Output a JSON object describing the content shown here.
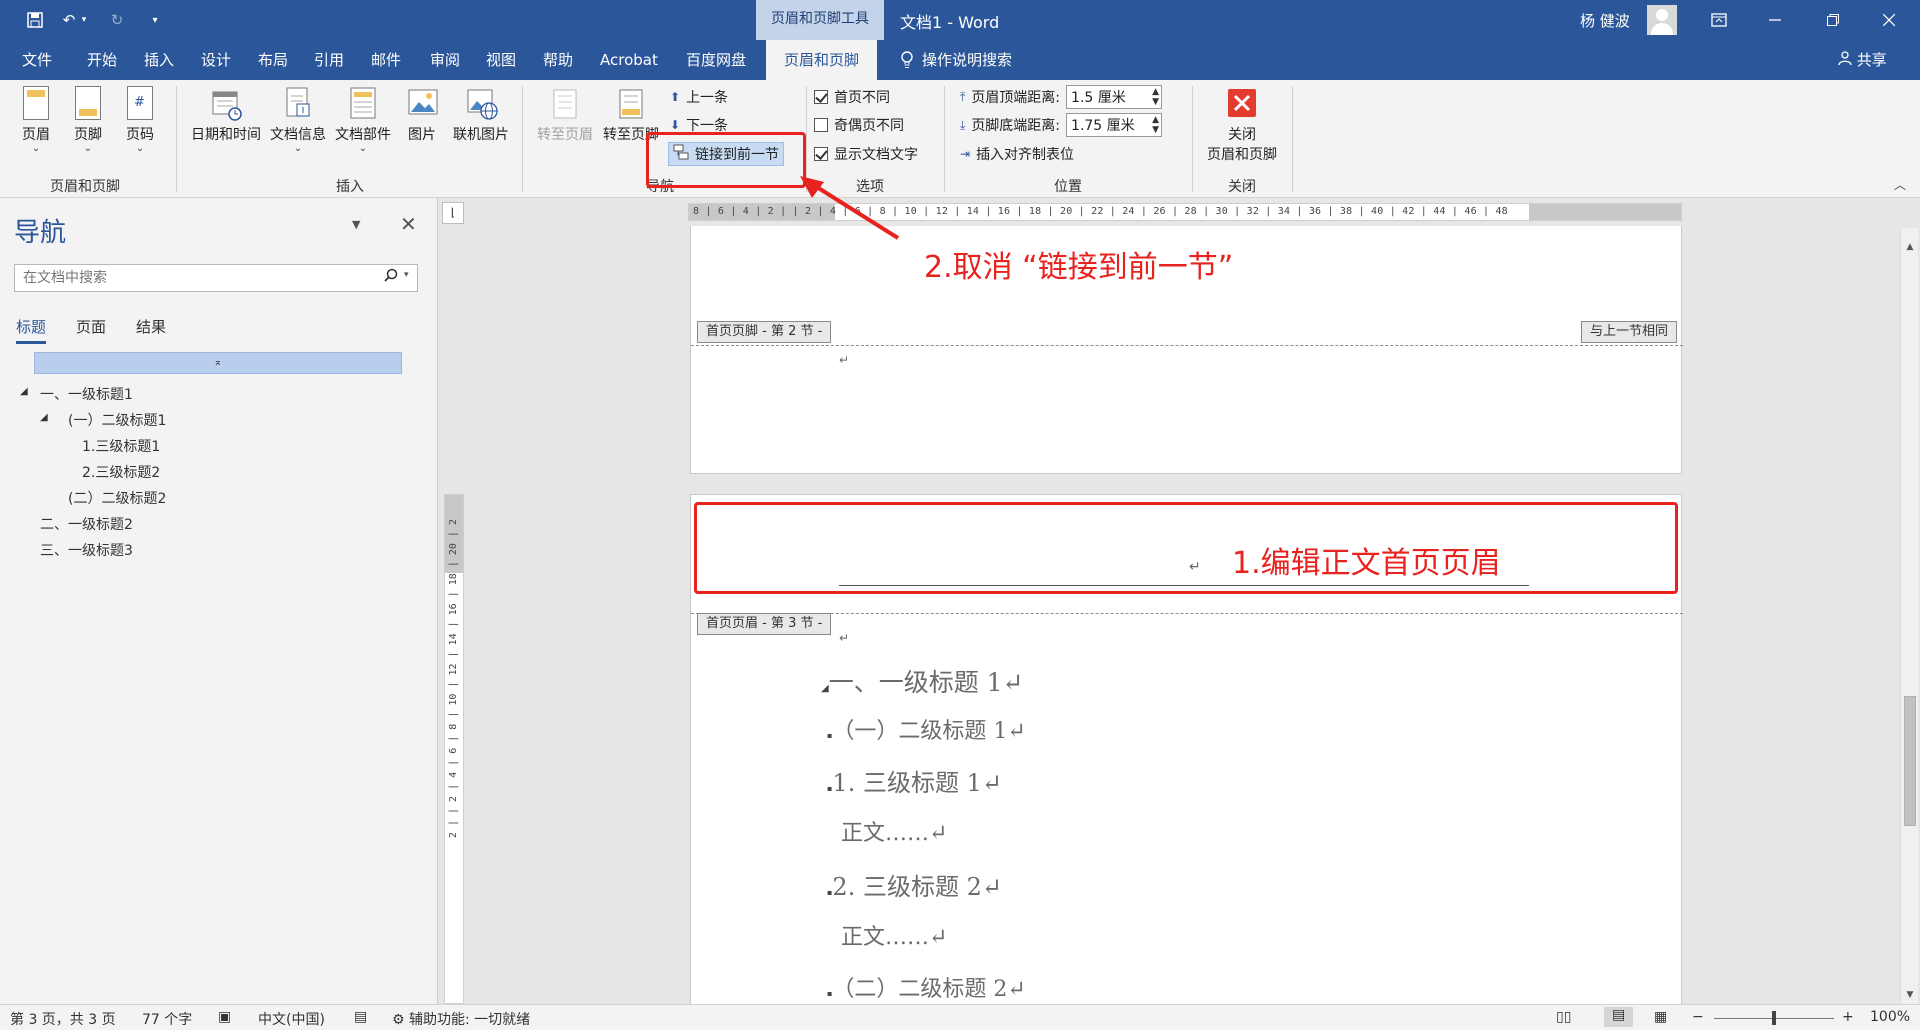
{
  "titlebar": {
    "context_tools": "页眉和页脚工具",
    "doc_title": "文档1  -  Word",
    "user_name": "杨 健波",
    "icons": [
      "save-icon",
      "undo-icon",
      "redo-icon",
      "customize-quick-access-icon"
    ]
  },
  "tabs": [
    "文件",
    "开始",
    "插入",
    "设计",
    "布局",
    "引用",
    "邮件",
    "审阅",
    "视图",
    "帮助",
    "Acrobat",
    "百度网盘",
    "页眉和页脚"
  ],
  "active_tab": "页眉和页脚",
  "tell_me": "操作说明搜索",
  "share": "共享",
  "ribbon": {
    "header_footer": {
      "header": "页眉",
      "footer": "页脚",
      "page_number": "页码",
      "group": "页眉和页脚"
    },
    "insert": {
      "date_time": "日期和时间",
      "doc_info": "文档信息",
      "doc_parts": "文档部件",
      "pictures": "图片",
      "online_pictures": "联机图片",
      "group": "插入"
    },
    "navigation": {
      "goto_header": "转至页眉",
      "goto_footer": "转至页脚",
      "previous": "上一条",
      "next": "下一条",
      "link_previous": "链接到前一节",
      "group": "导航"
    },
    "options": {
      "different_first": "首页不同",
      "different_odd_even": "奇偶页不同",
      "show_doc_text": "显示文档文字",
      "group": "选项",
      "different_first_checked": true,
      "different_odd_even_checked": false,
      "show_doc_text_checked": true
    },
    "position": {
      "header_top_label": "页眉顶端距离:",
      "header_top_value": "1.5 厘米",
      "footer_bottom_label": "页脚底端距离:",
      "footer_bottom_value": "1.75 厘米",
      "insert_align_tab": "插入对齐制表位",
      "group": "位置"
    },
    "close": {
      "label_line1": "关闭",
      "label_line2": "页眉和页脚",
      "group": "关闭"
    }
  },
  "nav_pane": {
    "title": "导航",
    "search_placeholder": "在文档中搜索",
    "tabs": [
      "标题",
      "页面",
      "结果"
    ],
    "tree": [
      {
        "text": "一、一级标题1",
        "level": 1
      },
      {
        "text": "(一）二级标题1",
        "level": 2
      },
      {
        "text": "1.三级标题1",
        "level": 3
      },
      {
        "text": "2.三级标题2",
        "level": 3
      },
      {
        "text": "(二）二级标题2",
        "level": 2
      },
      {
        "text": "二、一级标题2",
        "level": 1
      },
      {
        "text": "三、一级标题3",
        "level": 1
      }
    ]
  },
  "ruler": {
    "horizontal": "8 | 6 | 4 | 2 |     | 2 | 4 | 6 | 8 | 10 | 12 | 14 | 16 | 18 | 20 | 22 | 24 | 26 | 28 | 30 | 32 | 34 | 36 | 38 | 40 | 42 | 44 | 46 | 48",
    "vertical": "2 |  | 2 | 4 | 6 | 8 | 10 | 12 | 14 | 16 | 18 | 20 | 2"
  },
  "document": {
    "footer_tag": "首页页脚 - 第 2 节 -",
    "same_as_previous": "与上一节相同",
    "header_tag": "首页页眉 - 第 3 节 -",
    "paragraph_mark": "↵",
    "body": [
      {
        "text": "一、一级标题 1↵",
        "size": 25
      },
      {
        "text": "（一）二级标题 1↵",
        "size": 22
      },
      {
        "text": "1. 三级标题 1↵",
        "size": 24
      },
      {
        "text": "正文……↵",
        "size": 22
      },
      {
        "text": "2. 三级标题 2↵",
        "size": 24
      },
      {
        "text": "正文……↵",
        "size": 22
      },
      {
        "text": "（二）二级标题 2↵",
        "size": 22
      }
    ]
  },
  "annotations": {
    "step1": "1.编辑正文首页页眉",
    "step2": "2.取消 “链接到前一节”",
    "color": "#e8221e"
  },
  "status": {
    "page": "第 3 页，共 3 页",
    "words": "77 个字",
    "language": "中文(中国)",
    "accessibility": "辅助功能: 一切就绪",
    "zoom": "100%"
  },
  "colors": {
    "accent": "#2b579a",
    "ribbon": "#f3f3f3",
    "context_tab": "#c3d3e9"
  }
}
